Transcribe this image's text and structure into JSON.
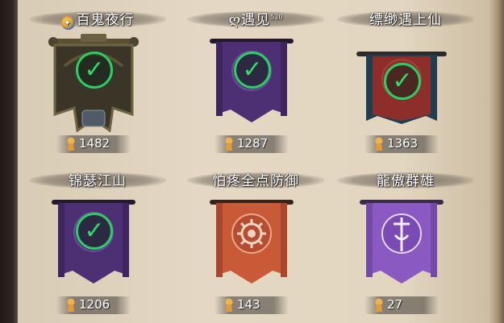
{
  "colors": {
    "check": "#2edb68",
    "purple": "#4d2f73",
    "crimson": "#8d2e2a",
    "orange": "#c85a38",
    "violet": "#8a5ac2",
    "olive": "#3a3526"
  },
  "guilds": [
    {
      "title": "百鬼夜行",
      "title_icon": "swirl-badge-icon",
      "title_sup": "",
      "score": "1482",
      "banner_style": "olive-cannon",
      "completed": true
    },
    {
      "title": "ღ遇见",
      "title_icon": "",
      "title_sup": "520",
      "score": "1287",
      "banner_style": "purple",
      "completed": true
    },
    {
      "title": "缥缈遇上仙",
      "title_icon": "",
      "title_sup": "",
      "score": "1363",
      "banner_style": "crimson",
      "completed": true
    },
    {
      "title": "锦瑟江山",
      "title_icon": "",
      "title_sup": "",
      "score": "1206",
      "banner_style": "purple",
      "completed": true
    },
    {
      "title": "怕疼全点防御",
      "title_icon": "",
      "title_sup": "",
      "score": "143",
      "banner_style": "orange-gear",
      "completed": false
    },
    {
      "title": "龍傲群雄",
      "title_icon": "",
      "title_sup": "",
      "score": "27",
      "banner_style": "violet-sword",
      "completed": false
    }
  ],
  "icons": {
    "score": "trophy-pin-icon",
    "check": "check-icon"
  }
}
